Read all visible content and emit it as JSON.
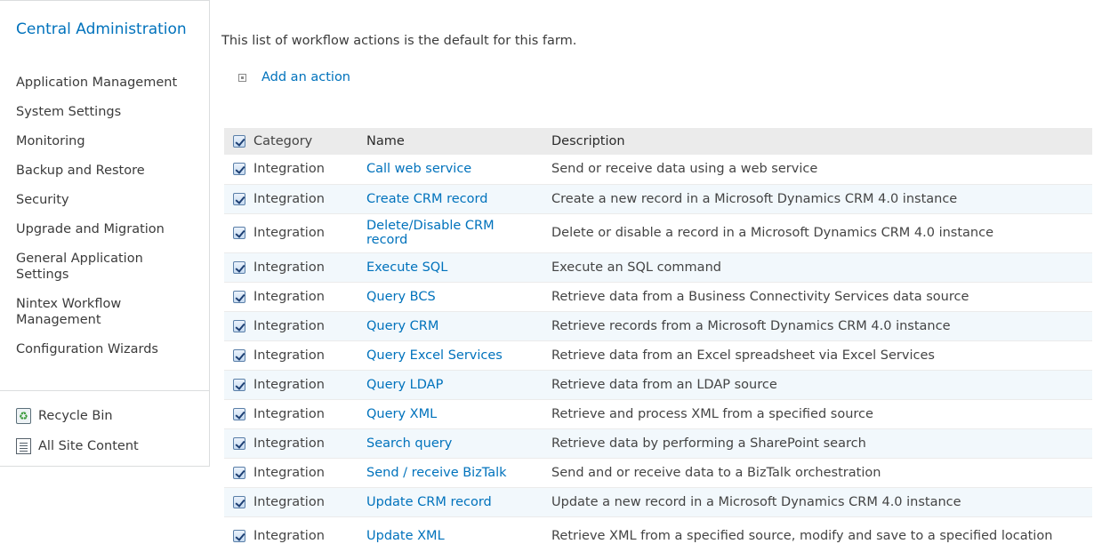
{
  "sidebar": {
    "title": "Central Administration",
    "items": [
      "Application Management",
      "System Settings",
      "Monitoring",
      "Backup and Restore",
      "Security",
      "Upgrade and Migration",
      "General Application Settings",
      "Nintex Workflow Management",
      "Configuration Wizards"
    ],
    "recycle_bin": "Recycle Bin",
    "all_site_content": "All Site Content"
  },
  "main": {
    "intro": "This list of workflow actions is the default for this farm.",
    "add_action": "Add an action"
  },
  "table": {
    "headers": {
      "category": "Category",
      "name": "Name",
      "description": "Description"
    },
    "rows": [
      {
        "category": "Integration",
        "name": "Call web service",
        "description": "Send or receive data using a web service"
      },
      {
        "category": "Integration",
        "name": "Create CRM record",
        "description": "Create a new record in a Microsoft Dynamics CRM 4.0 instance"
      },
      {
        "category": "Integration",
        "name": "Delete/Disable CRM record",
        "description": "Delete or disable a record in a Microsoft Dynamics CRM 4.0 instance"
      },
      {
        "category": "Integration",
        "name": "Execute SQL",
        "description": "Execute an SQL command"
      },
      {
        "category": "Integration",
        "name": "Query BCS",
        "description": "Retrieve data from a Business Connectivity Services data source"
      },
      {
        "category": "Integration",
        "name": "Query CRM",
        "description": "Retrieve records from a Microsoft Dynamics CRM 4.0 instance"
      },
      {
        "category": "Integration",
        "name": "Query Excel Services",
        "description": "Retrieve data from an Excel spreadsheet via Excel Services"
      },
      {
        "category": "Integration",
        "name": "Query LDAP",
        "description": "Retrieve data from an LDAP source"
      },
      {
        "category": "Integration",
        "name": "Query XML",
        "description": "Retrieve and process XML from a specified source"
      },
      {
        "category": "Integration",
        "name": "Search query",
        "description": "Retrieve data by performing a SharePoint search"
      },
      {
        "category": "Integration",
        "name": "Send / receive BizTalk",
        "description": "Send and or receive data to a BizTalk orchestration"
      },
      {
        "category": "Integration",
        "name": "Update CRM record",
        "description": "Update a new record in a Microsoft Dynamics CRM 4.0 instance"
      },
      {
        "category": "Integration",
        "name": "Update XML",
        "description": "Retrieve XML from a specified source, modify and save to a specified location"
      }
    ]
  },
  "colors": {
    "link": "#0072bc",
    "header_bg": "#ebebeb",
    "alt_row_bg": "#f2f8fc",
    "border": "#dbddde"
  }
}
